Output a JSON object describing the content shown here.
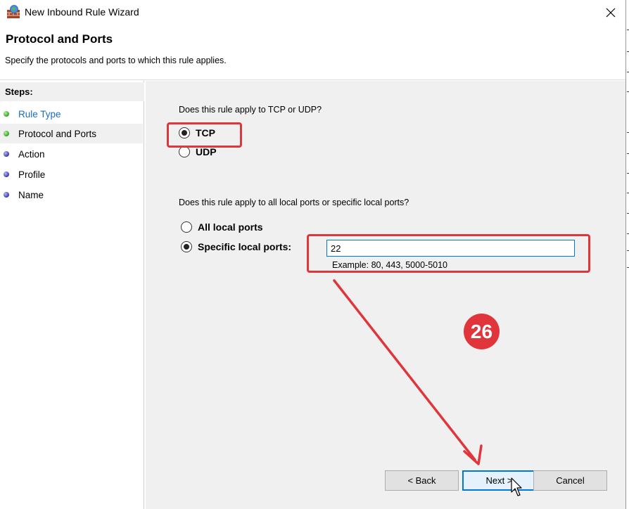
{
  "window": {
    "title": "New Inbound Rule Wizard",
    "close_icon": "close-icon"
  },
  "header": {
    "title": "Protocol and Ports",
    "subtitle": "Specify the protocols and ports to which this rule applies."
  },
  "steps": {
    "heading": "Steps:",
    "items": [
      {
        "label": "Rule Type",
        "status": "complete",
        "dot_color": "#35a22b"
      },
      {
        "label": "Protocol and Ports",
        "status": "current",
        "dot_color": "#35a22b"
      },
      {
        "label": "Action",
        "status": "pending",
        "dot_color": "#3737b0"
      },
      {
        "label": "Profile",
        "status": "pending",
        "dot_color": "#3737b0"
      },
      {
        "label": "Name",
        "status": "pending",
        "dot_color": "#3737b0"
      }
    ]
  },
  "protocol": {
    "question": "Does this rule apply to TCP or UDP?",
    "options": [
      {
        "label": "TCP",
        "selected": true
      },
      {
        "label": "UDP",
        "selected": false
      }
    ]
  },
  "ports": {
    "question": "Does this rule apply to all local ports or specific local ports?",
    "all_label": "All local ports",
    "specific_label": "Specific local ports:",
    "all_selected": false,
    "specific_selected": true,
    "value": "22",
    "example": "Example: 80, 443, 5000-5010"
  },
  "buttons": {
    "back": "< Back",
    "next": "Next >",
    "cancel": "Cancel"
  },
  "annotation": {
    "step_number": "26",
    "color": "#e0353b"
  }
}
